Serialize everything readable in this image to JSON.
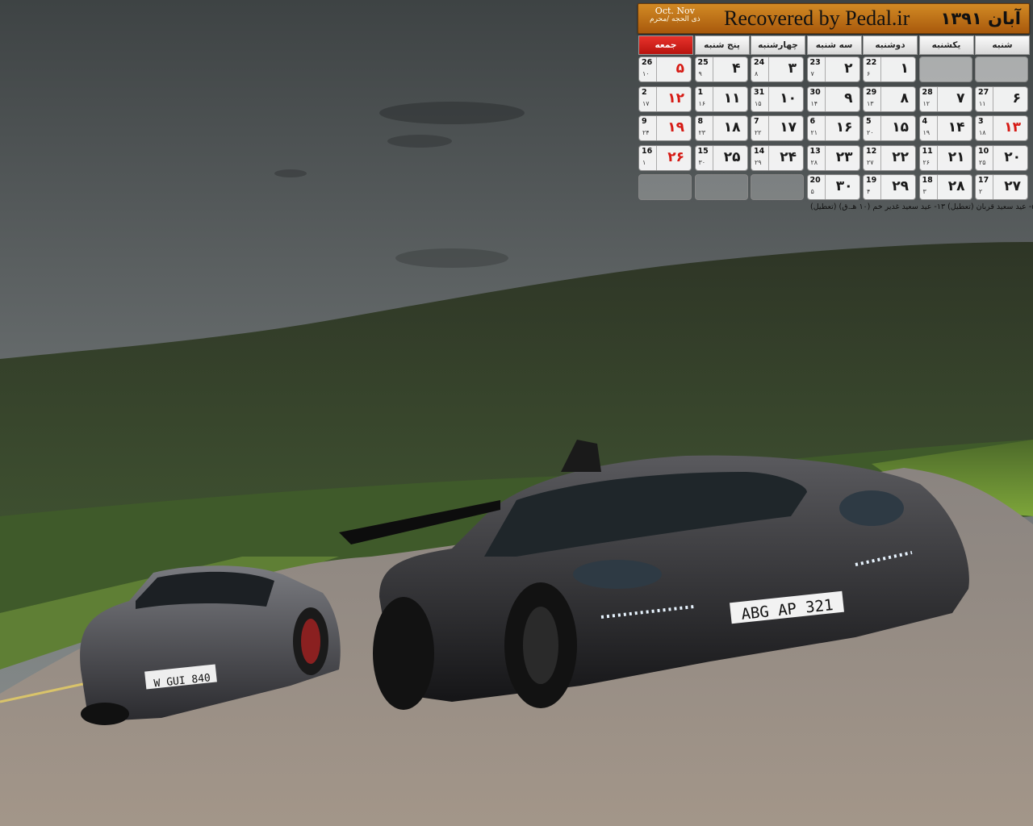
{
  "header": {
    "gregorian_month": "Oct. Nov",
    "hijri_month": "ذی الحجه /محرم",
    "site": "Recovered by Pedal.ir",
    "persian_month": "آبان ۱۳۹۱"
  },
  "weekdays": [
    "شنبه",
    "یکشنبه",
    "دوشنبه",
    "سه شنبه",
    "چهارشنبه",
    "پنج شنبه",
    "جمعه"
  ],
  "weeks": [
    [
      {
        "p": "",
        "g": "",
        "h": ""
      },
      {
        "p": "",
        "g": "",
        "h": ""
      },
      {
        "p": "۱",
        "g": "22",
        "h": "۶"
      },
      {
        "p": "۲",
        "g": "23",
        "h": "۷"
      },
      {
        "p": "۳",
        "g": "24",
        "h": "۸"
      },
      {
        "p": "۴",
        "g": "25",
        "h": "۹"
      },
      {
        "p": "۵",
        "g": "26",
        "h": "۱۰"
      }
    ],
    [
      {
        "p": "۶",
        "g": "27",
        "h": "۱۱"
      },
      {
        "p": "۷",
        "g": "28",
        "h": "۱۲"
      },
      {
        "p": "۸",
        "g": "29",
        "h": "۱۳"
      },
      {
        "p": "۹",
        "g": "30",
        "h": "۱۴"
      },
      {
        "p": "۱۰",
        "g": "31",
        "h": "۱۵"
      },
      {
        "p": "۱۱",
        "g": "1",
        "h": "۱۶"
      },
      {
        "p": "۱۲",
        "g": "2",
        "h": "۱۷"
      }
    ],
    [
      {
        "p": "۱۳",
        "g": "3",
        "h": "۱۸"
      },
      {
        "p": "۱۴",
        "g": "4",
        "h": "۱۹"
      },
      {
        "p": "۱۵",
        "g": "5",
        "h": "۲۰"
      },
      {
        "p": "۱۶",
        "g": "6",
        "h": "۲۱"
      },
      {
        "p": "۱۷",
        "g": "7",
        "h": "۲۲"
      },
      {
        "p": "۱۸",
        "g": "8",
        "h": "۲۳"
      },
      {
        "p": "۱۹",
        "g": "9",
        "h": "۲۴"
      }
    ],
    [
      {
        "p": "۲۰",
        "g": "10",
        "h": "۲۵"
      },
      {
        "p": "۲۱",
        "g": "11",
        "h": "۲۶"
      },
      {
        "p": "۲۲",
        "g": "12",
        "h": "۲۷"
      },
      {
        "p": "۲۳",
        "g": "13",
        "h": "۲۸"
      },
      {
        "p": "۲۴",
        "g": "14",
        "h": "۲۹"
      },
      {
        "p": "۲۵",
        "g": "15",
        "h": "۳۰"
      },
      {
        "p": "۲۶",
        "g": "16",
        "h": "۱"
      }
    ],
    [
      {
        "p": "۲۷",
        "g": "17",
        "h": "۲"
      },
      {
        "p": "۲۸",
        "g": "18",
        "h": "۳"
      },
      {
        "p": "۲۹",
        "g": "19",
        "h": "۴"
      },
      {
        "p": "۳۰",
        "g": "20",
        "h": "۵"
      },
      {
        "p": "",
        "g": "",
        "h": ""
      },
      {
        "p": "",
        "g": "",
        "h": ""
      },
      {
        "p": "",
        "g": "",
        "h": ""
      }
    ]
  ],
  "holiday_days": [
    "۵",
    "۱۲",
    "۱۳",
    "۱۹",
    "۲۶"
  ],
  "holiday_note": "۵- عید سعید قربان (تعطیل) ۱۳- عید سعید غدیر خم (۱۰ هـ.ق) (تعطیل)",
  "plates": {
    "front_car": "ABG AP 321",
    "rear_car": "W GUI 840"
  },
  "colors": {
    "header_orange": "#c47a1c",
    "friday_red": "#d61a14"
  }
}
